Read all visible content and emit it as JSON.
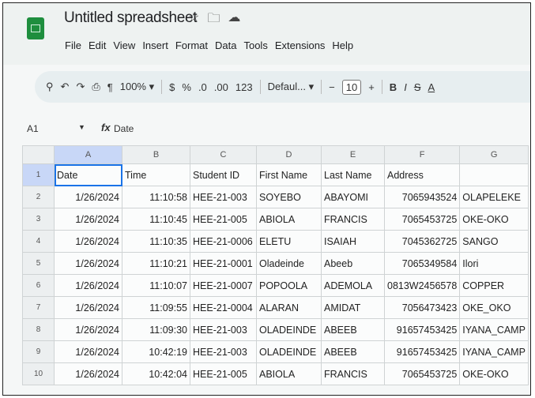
{
  "doc": {
    "title": "Untitled spreadsheet",
    "title_icons": [
      "star-icon",
      "move-to-folder-icon",
      "cloud-status-icon"
    ]
  },
  "menu": [
    "File",
    "Edit",
    "View",
    "Insert",
    "Format",
    "Data",
    "Tools",
    "Extensions",
    "Help"
  ],
  "toolbar": {
    "zoom": "100%",
    "currency": "$",
    "percent": "%",
    "decrease_decimal": ".0",
    "increase_decimal": ".00",
    "number_format": "123",
    "font": "Defaul...",
    "font_size": "10",
    "minus": "−",
    "plus": "+",
    "bold": "B",
    "italic": "I",
    "strike": "S",
    "text_color": "A"
  },
  "formula_bar": {
    "cell_ref": "A1",
    "fx": "fx",
    "content": "Date"
  },
  "grid": {
    "columns": [
      "A",
      "B",
      "C",
      "D",
      "E",
      "F",
      "G"
    ],
    "rows": [
      {
        "n": "1",
        "cells": [
          "Date",
          "Time",
          "Student ID",
          "First Name",
          "Last Name",
          "Address",
          ""
        ]
      },
      {
        "n": "2",
        "cells": [
          "1/26/2024",
          "11:10:58",
          "HEE-21-003",
          "SOYEBO",
          "ABAYOMI",
          "7065943524",
          "OLAPELEKE"
        ]
      },
      {
        "n": "3",
        "cells": [
          "1/26/2024",
          "11:10:45",
          "HEE-21-005",
          "ABIOLA",
          "FRANCIS",
          "7065453725",
          "OKE-OKO"
        ]
      },
      {
        "n": "4",
        "cells": [
          "1/26/2024",
          "11:10:35",
          "HEE-21-0006",
          "ELETU",
          "ISAIAH",
          "7045362725",
          "SANGO"
        ]
      },
      {
        "n": "5",
        "cells": [
          "1/26/2024",
          "11:10:21",
          "HEE-21-0001",
          "Oladeinde",
          "Abeeb",
          "7065349584",
          "Ilori"
        ]
      },
      {
        "n": "6",
        "cells": [
          "1/26/2024",
          "11:10:07",
          "HEE-21-0007",
          "POPOOLA",
          "ADEMOLA",
          "0813W2456578",
          "COPPER"
        ]
      },
      {
        "n": "7",
        "cells": [
          "1/26/2024",
          "11:09:55",
          "HEE-21-0004",
          "ALARAN",
          "AMIDAT",
          "7056473423",
          "OKE_OKO"
        ]
      },
      {
        "n": "8",
        "cells": [
          "1/26/2024",
          "11:09:30",
          "HEE-21-003",
          "OLADEINDE",
          "ABEEB",
          "91657453425",
          "IYANA_CAMP"
        ]
      },
      {
        "n": "9",
        "cells": [
          "1/26/2024",
          "10:42:19",
          "HEE-21-003",
          "OLADEINDE",
          "ABEEB",
          "91657453425",
          "IYANA_CAMP"
        ]
      },
      {
        "n": "10",
        "cells": [
          "1/26/2024",
          "10:42:04",
          "HEE-21-005",
          "ABIOLA",
          "FRANCIS",
          "7065453725",
          "OKE-OKO"
        ]
      }
    ]
  }
}
